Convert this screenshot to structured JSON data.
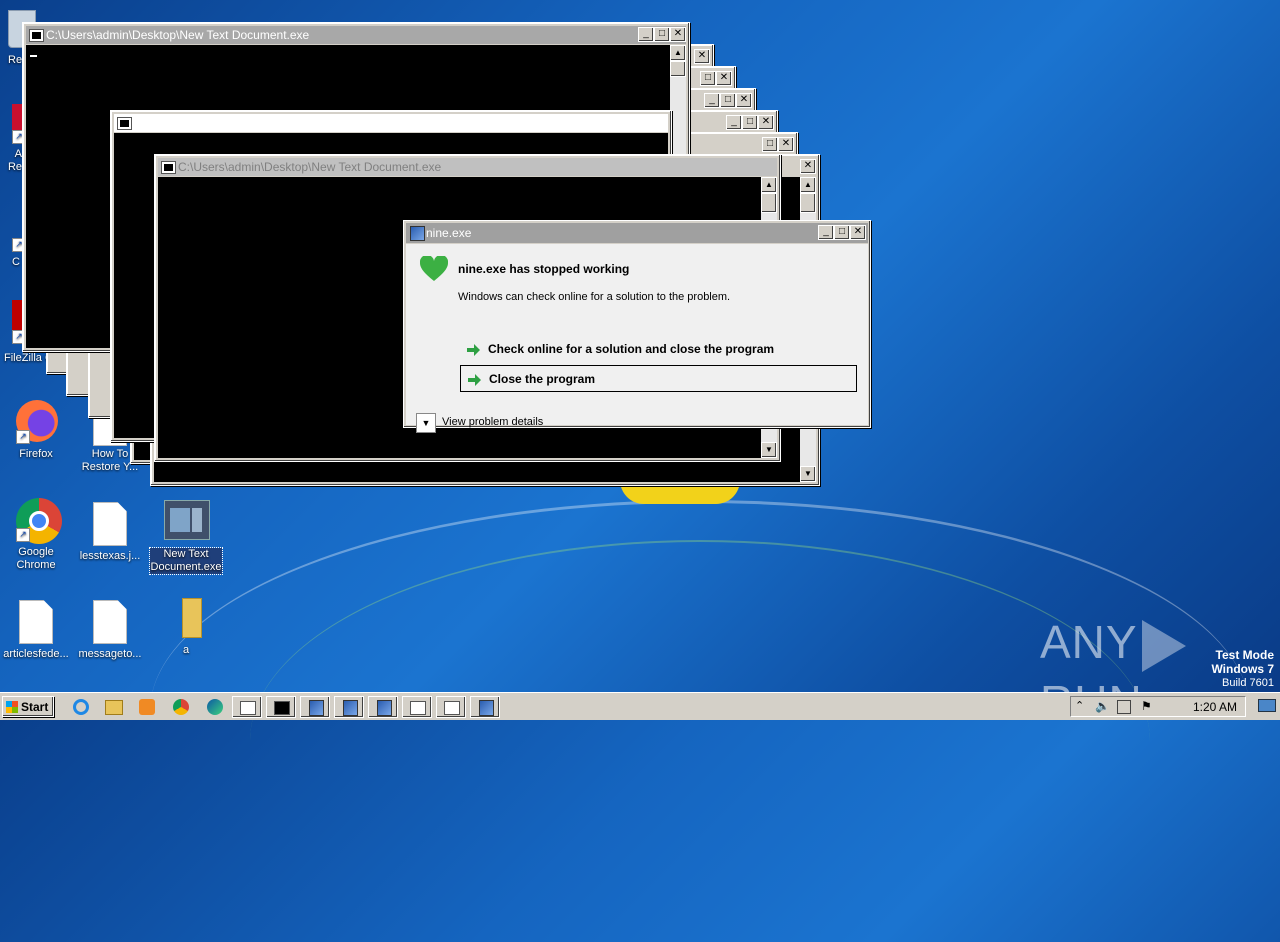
{
  "desktop_icons": [
    {
      "id": "recycle",
      "label": "Re"
    },
    {
      "id": "acrobat",
      "label": "A\nRe"
    },
    {
      "id": "ccleaner",
      "label": "C"
    },
    {
      "id": "filezilla",
      "label": "FileZilla C"
    },
    {
      "id": "firefox",
      "label": "Firefox"
    },
    {
      "id": "how-to",
      "label": "How To\nRestore Y..."
    },
    {
      "id": "chrome",
      "label": "Google\nChrome"
    },
    {
      "id": "lesstexas",
      "label": "lesstexas.j..."
    },
    {
      "id": "newtext",
      "label": "New Text\nDocument.exe"
    },
    {
      "id": "articles",
      "label": "articlesfede..."
    },
    {
      "id": "message",
      "label": "messageto..."
    },
    {
      "id": "folder-a",
      "label": "a"
    }
  ],
  "console_windows": {
    "top_title": "C:\\Users\\admin\\Desktop\\New Text Document.exe",
    "mid_title": "",
    "front_title": "C:\\Users\\admin\\Desktop\\New Text Document.exe"
  },
  "dialog": {
    "title": "nine.exe",
    "heading": "nine.exe has stopped working",
    "message": "Windows can check online for a solution to the problem.",
    "option1": "Check online for a solution and close the program",
    "option2": "Close the program",
    "details": "View problem details"
  },
  "watermark": {
    "brand_left": "ANY",
    "brand_right": "RUN",
    "line1": "Test Mode",
    "line2": "Windows 7",
    "line3": "Build 7601"
  },
  "taskbar": {
    "start_label": "Start",
    "clock": "1:20 AM"
  },
  "colors": {
    "desktop_blue": "#1565c0",
    "dialog_icon_green": "#3cb043",
    "arrow_green": "#2ea043"
  }
}
